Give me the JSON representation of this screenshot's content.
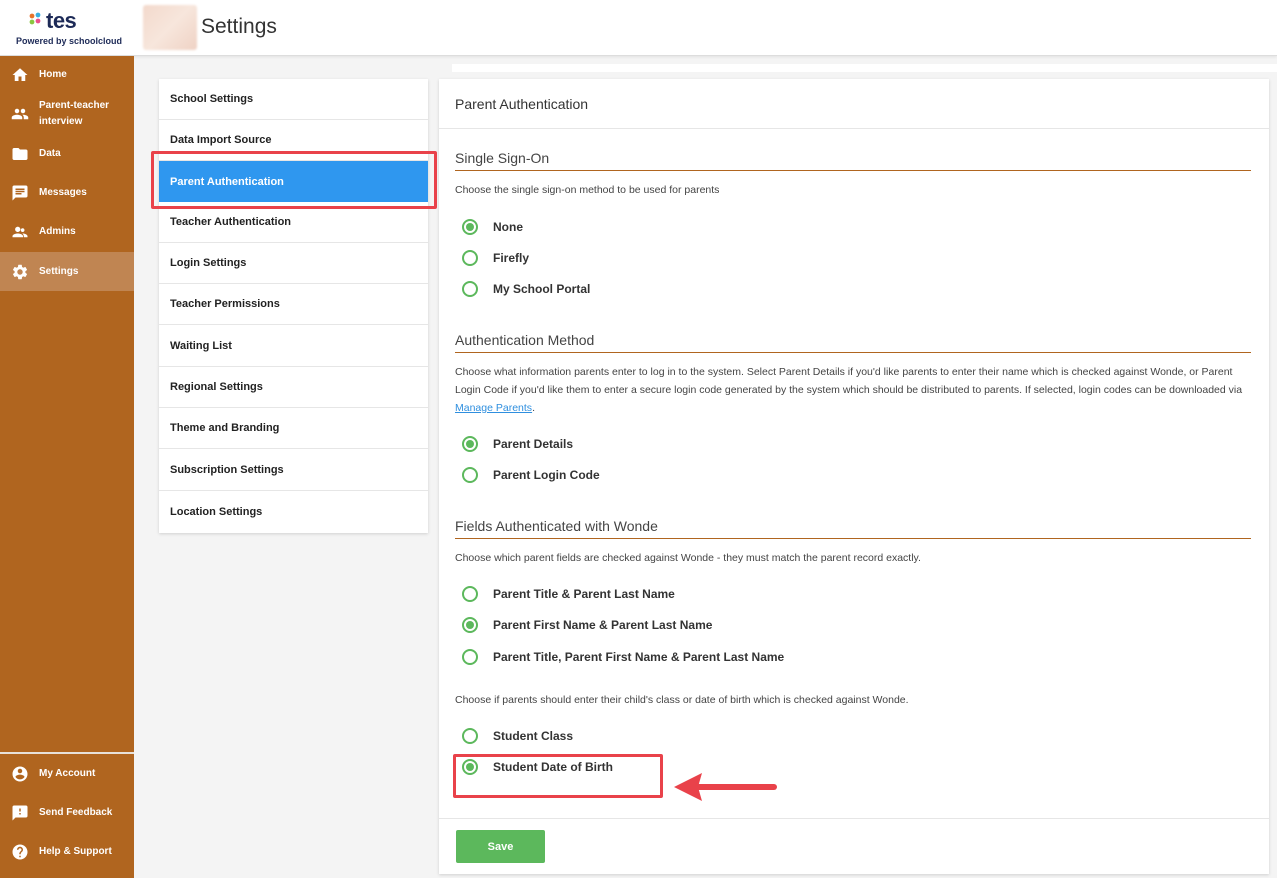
{
  "header": {
    "logo_text": "tes",
    "powered_by": "Powered by schoolcloud",
    "page_title": "Settings"
  },
  "sidebar": {
    "items": [
      {
        "label": "Home",
        "icon": "home-icon"
      },
      {
        "label": "Parent-teacher interview",
        "icon": "people-icon"
      },
      {
        "label": "Data",
        "icon": "folder-icon"
      },
      {
        "label": "Messages",
        "icon": "message-icon"
      },
      {
        "label": "Admins",
        "icon": "admins-icon"
      },
      {
        "label": "Settings",
        "icon": "gear-icon"
      }
    ],
    "bottom_items": [
      {
        "label": "My Account",
        "icon": "account-icon"
      },
      {
        "label": "Send Feedback",
        "icon": "feedback-icon"
      },
      {
        "label": "Help & Support",
        "icon": "help-icon"
      }
    ],
    "active": "Settings"
  },
  "settings_menu": {
    "items": [
      "School Settings",
      "Data Import Source",
      "Parent Authentication",
      "Teacher Authentication",
      "Login Settings",
      "Teacher Permissions",
      "Waiting List",
      "Regional Settings",
      "Theme and Branding",
      "Subscription Settings",
      "Location Settings"
    ],
    "active": "Parent Authentication"
  },
  "panel": {
    "title": "Parent Authentication",
    "sso": {
      "title": "Single Sign-On",
      "description": "Choose the single sign-on method to be used for parents",
      "options": [
        {
          "label": "None",
          "checked": true
        },
        {
          "label": "Firefly",
          "checked": false
        },
        {
          "label": "My School Portal",
          "checked": false
        }
      ]
    },
    "auth_method": {
      "title": "Authentication Method",
      "description": "Choose what information parents enter to log in to the system. Select Parent Details if you'd like parents to enter their name which is checked against Wonde, or Parent Login Code if you'd like them to enter a secure login code generated by the system which should be distributed to parents. If selected, login codes can be downloaded via",
      "link": "Manage Parents",
      "description_end": ".",
      "options": [
        {
          "label": "Parent Details",
          "checked": true
        },
        {
          "label": "Parent Login Code",
          "checked": false
        }
      ]
    },
    "fields": {
      "title": "Fields Authenticated with Wonde",
      "description": "Choose which parent fields are checked against Wonde - they must match the parent record exactly.",
      "options": [
        {
          "label": "Parent Title & Parent Last Name",
          "checked": false
        },
        {
          "label": "Parent First Name & Parent Last Name",
          "checked": true
        },
        {
          "label": "Parent Title, Parent First Name & Parent Last Name",
          "checked": false
        }
      ],
      "student_description": "Choose if parents should enter their child's class or date of birth which is checked against Wonde.",
      "student_options": [
        {
          "label": "Student Class",
          "checked": false
        },
        {
          "label": "Student Date of Birth",
          "checked": true
        }
      ]
    },
    "save_label": "Save"
  },
  "colors": {
    "sidebar": "#b0651f",
    "accent_blue": "#2f97ef",
    "radio_green": "#5cb85c",
    "highlight_red": "#e9424a"
  }
}
